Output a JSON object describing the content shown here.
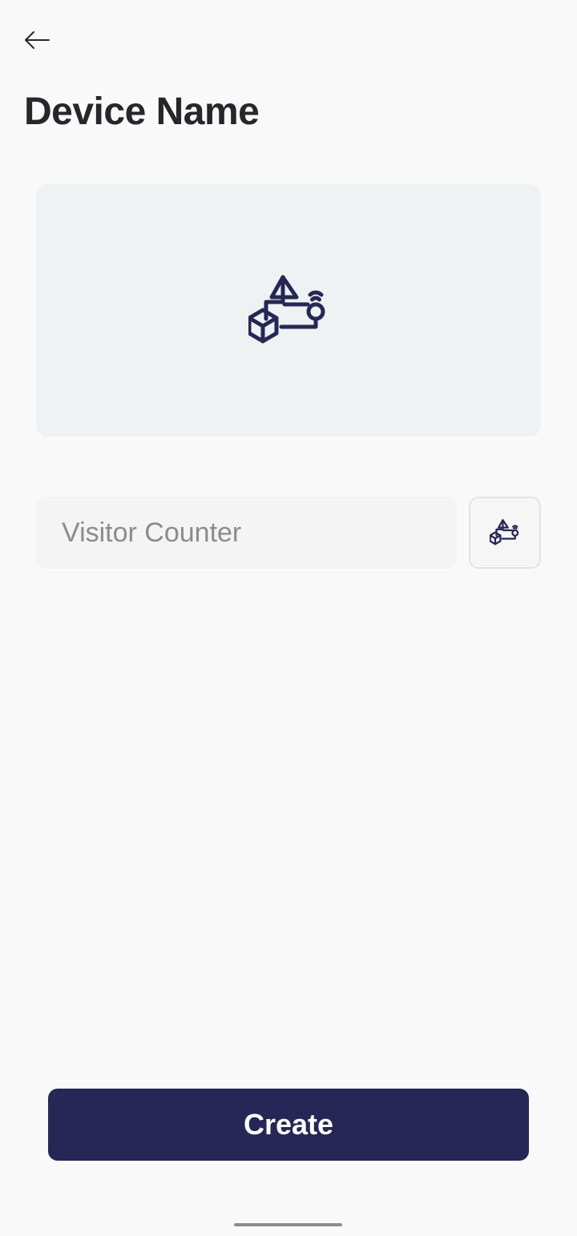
{
  "header": {
    "back_icon": "arrow-left-icon",
    "title": "Device Name"
  },
  "preview": {
    "icon": "device-automation-icon",
    "icon_color": "#262756",
    "background": "#eff2f2"
  },
  "name_field": {
    "value": "",
    "placeholder": "Visitor Counter"
  },
  "icon_picker": {
    "icon": "device-automation-icon"
  },
  "footer": {
    "create_label": "Create",
    "button_color": "#262756"
  }
}
